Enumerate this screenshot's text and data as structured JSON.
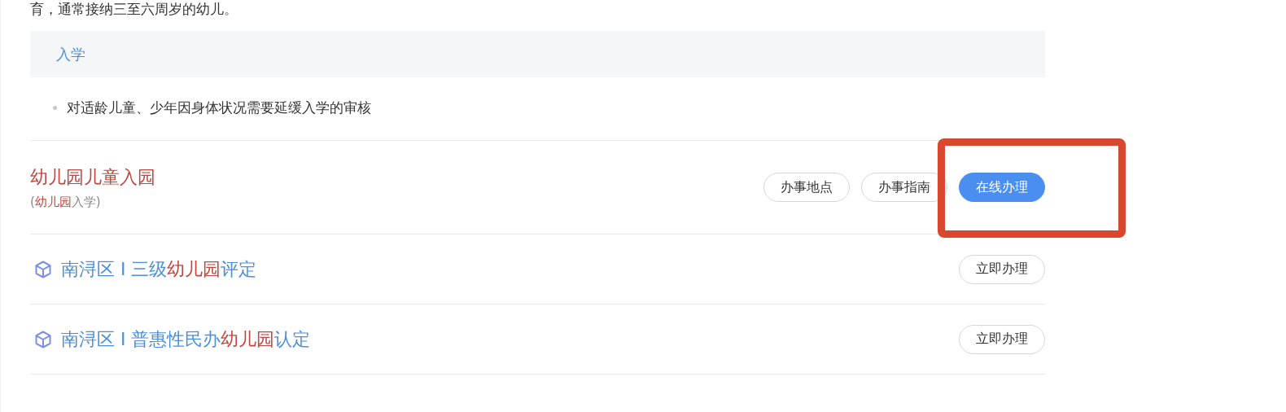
{
  "intro_text": "育，通常接纳三至六周岁的幼儿。",
  "category": {
    "label": "入学"
  },
  "bullets": [
    "对适龄儿童、少年因身体状况需要延缓入学的审核"
  ],
  "services": [
    {
      "kind": "main",
      "title": [
        {
          "text": "幼儿园儿童入园",
          "highlighted": false
        }
      ],
      "subtitle": [
        {
          "text": "(",
          "highlighted": false
        },
        {
          "text": "幼儿园",
          "highlighted": true
        },
        {
          "text": "入学)",
          "highlighted": false
        }
      ],
      "buttons": [
        {
          "label": "办事地点",
          "primary": false,
          "annotated": false
        },
        {
          "label": "办事指南",
          "primary": false,
          "annotated": false
        },
        {
          "label": "在线办理",
          "primary": true,
          "annotated": true
        }
      ]
    },
    {
      "kind": "linked",
      "title": [
        {
          "text": "南浔区 I 三级",
          "highlighted": false
        },
        {
          "text": "幼儿园",
          "highlighted": true
        },
        {
          "text": "评定",
          "highlighted": false
        }
      ],
      "buttons": [
        {
          "label": "立即办理",
          "primary": false,
          "annotated": false
        }
      ]
    },
    {
      "kind": "linked",
      "title": [
        {
          "text": "南浔区 I 普惠性民办",
          "highlighted": false
        },
        {
          "text": "幼儿园",
          "highlighted": true
        },
        {
          "text": "认定",
          "highlighted": false
        }
      ],
      "buttons": [
        {
          "label": "立即办理",
          "primary": false,
          "annotated": false
        }
      ]
    }
  ]
}
